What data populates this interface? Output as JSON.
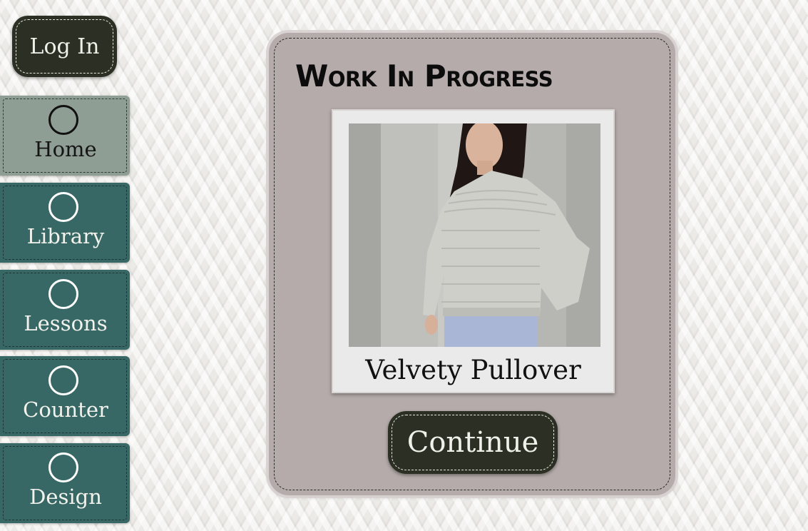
{
  "header": {
    "login_label": "Log In"
  },
  "nav": {
    "items": [
      {
        "label": "Home",
        "icon": "circle-icon",
        "active": true
      },
      {
        "label": "Library",
        "icon": "circle-icon",
        "active": false
      },
      {
        "label": "Lessons",
        "icon": "circle-icon",
        "active": false
      },
      {
        "label": "Counter",
        "icon": "circle-icon",
        "active": false
      },
      {
        "label": "Design",
        "icon": "circle-icon",
        "active": false
      }
    ]
  },
  "main": {
    "title": "Work In Progress",
    "project": {
      "name": "Velvety Pullover",
      "image": "woman-wearing-grey-knit-sweater-photo"
    },
    "continue_label": "Continue"
  },
  "colors": {
    "dark_button": "#2c3024",
    "nav_active": "#8f9e95",
    "nav_inactive": "#376866",
    "card": "#b4abaa",
    "page_background": "#ebeae6"
  }
}
